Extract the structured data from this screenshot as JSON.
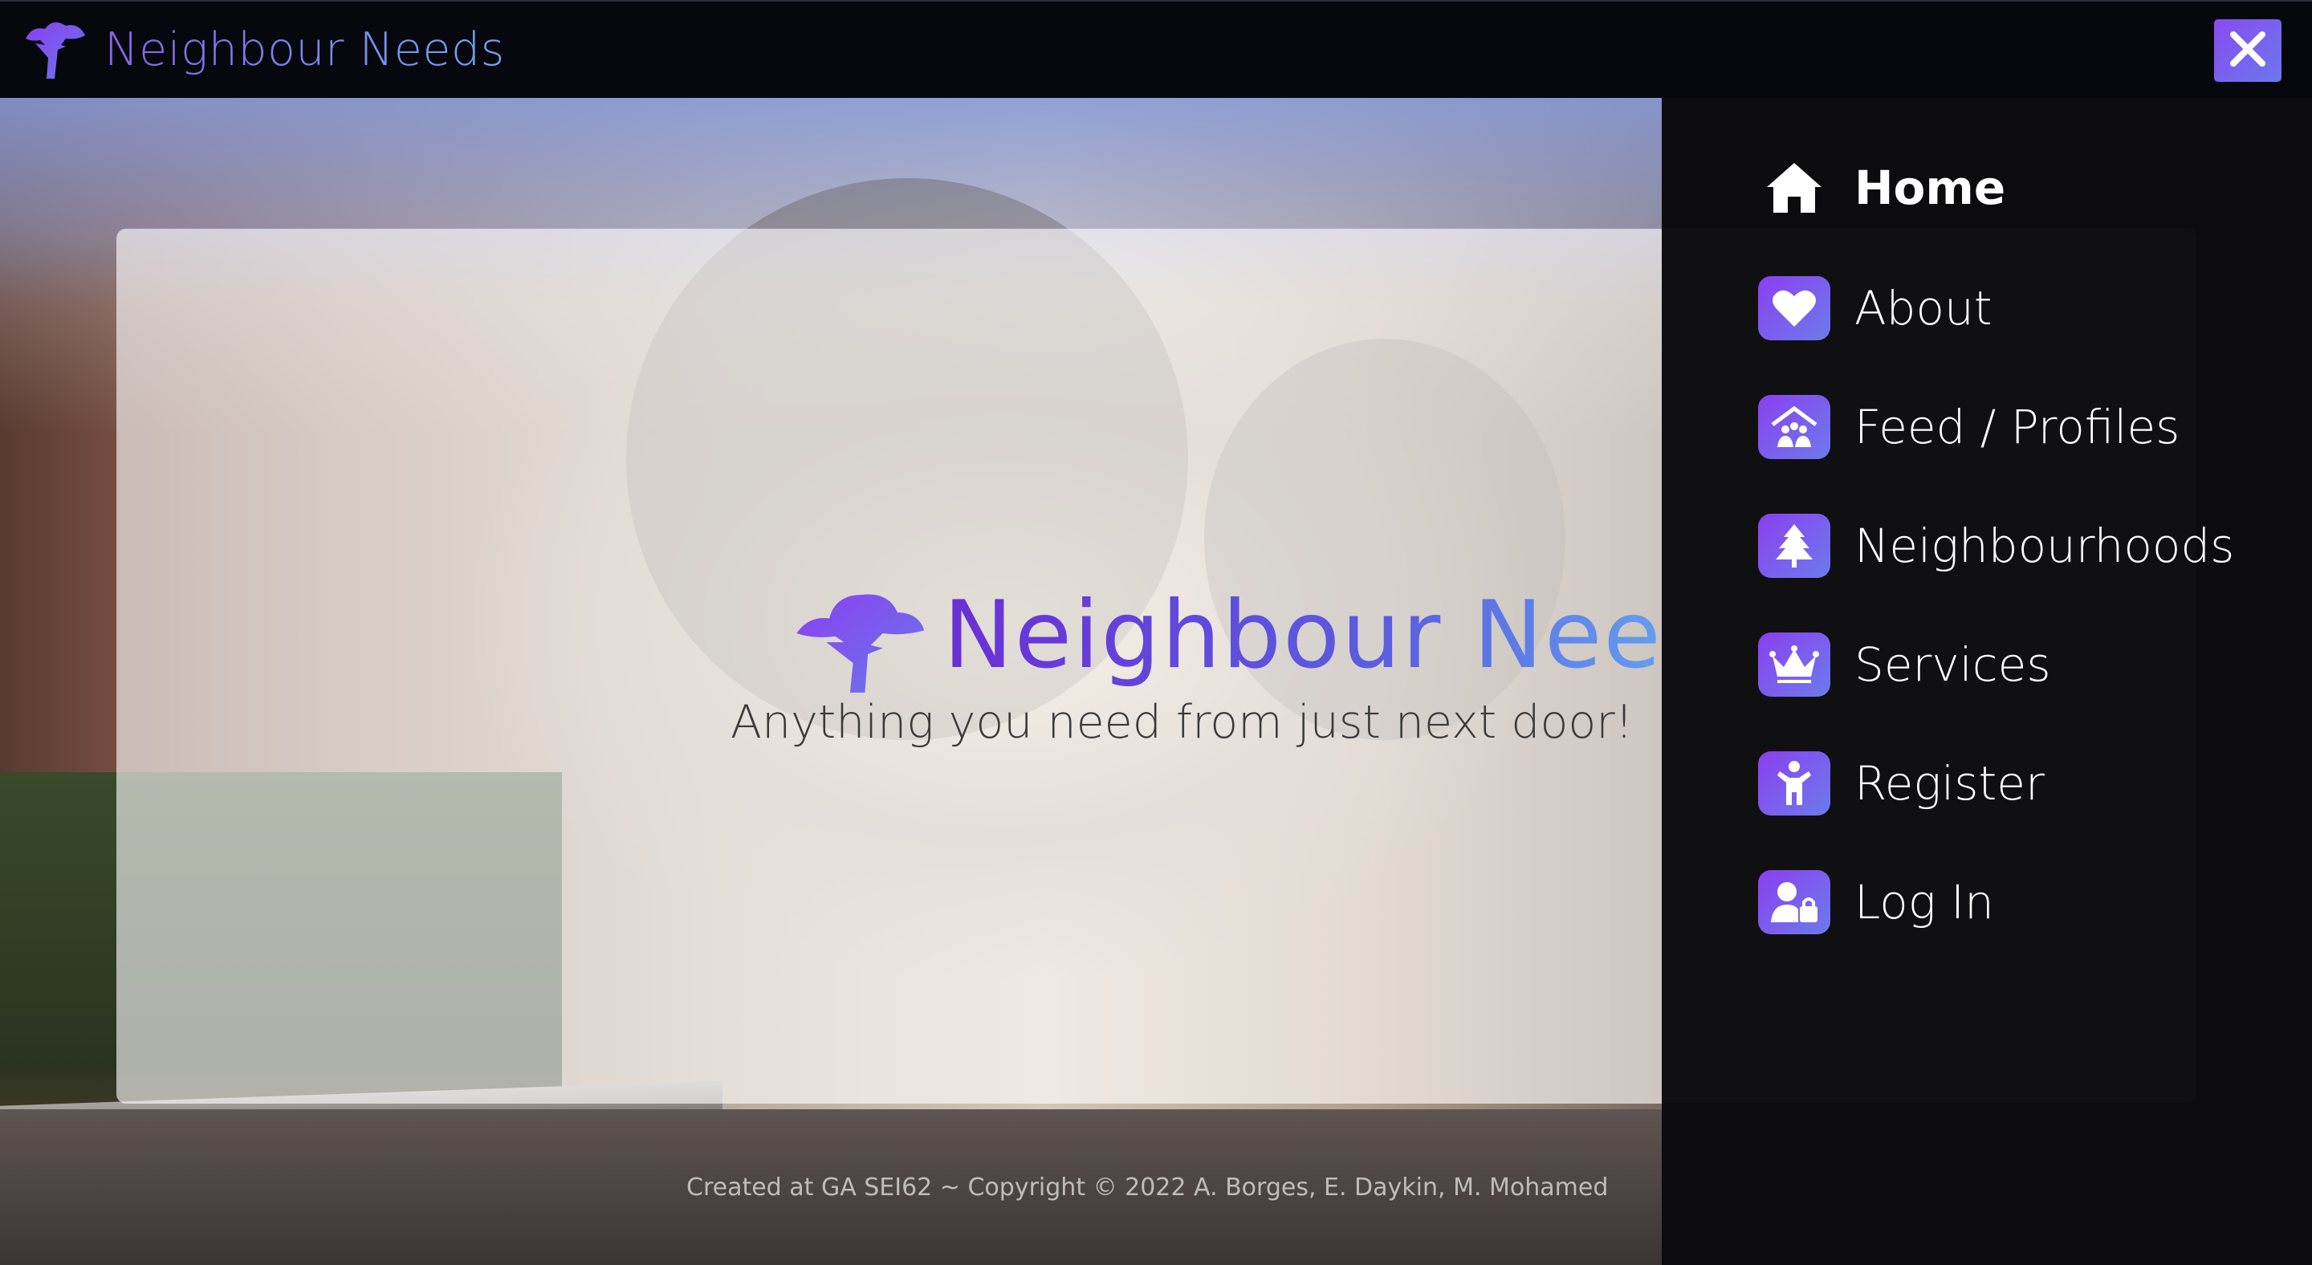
{
  "header": {
    "brand_name": "Neighbour Needs",
    "logo_icon": "tree-icon",
    "close_icon": "close-icon",
    "accent_color": "#7a4ff0"
  },
  "hero": {
    "title": "Neighbour Needs",
    "tagline": "Anything you need from just next door!"
  },
  "menu": {
    "items": [
      {
        "label": "Home",
        "icon": "home-icon",
        "active": true
      },
      {
        "label": "About",
        "icon": "heart-icon",
        "active": false
      },
      {
        "label": "Feed / Profiles",
        "icon": "people-house-icon",
        "active": false
      },
      {
        "label": "Neighbourhoods",
        "icon": "tree-icon",
        "active": false
      },
      {
        "label": "Services",
        "icon": "crown-icon",
        "active": false
      },
      {
        "label": "Register",
        "icon": "person-icon",
        "active": false
      },
      {
        "label": "Log In",
        "icon": "user-lock-icon",
        "active": false
      }
    ]
  },
  "footer": {
    "credits": "Created at GA SEI62 ~ Copyright © 2022 A. Borges, E. Daykin, M. Mohamed"
  }
}
